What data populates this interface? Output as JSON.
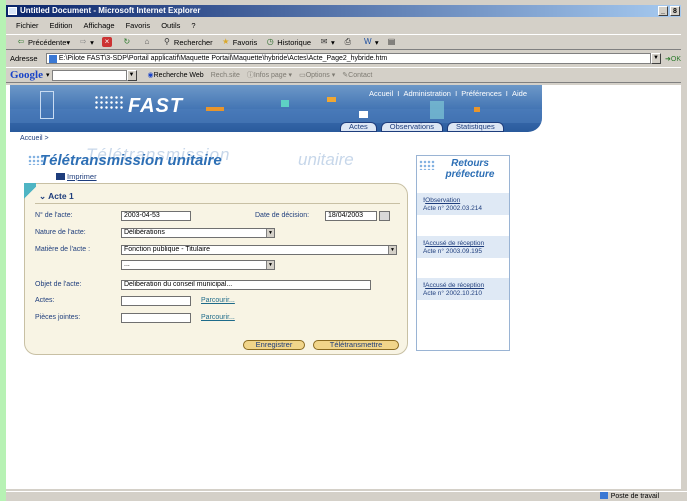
{
  "window": {
    "title": "Untitled Document - Microsoft Internet Explorer",
    "controls": [
      "_",
      "8"
    ]
  },
  "menu": [
    "Fichier",
    "Edition",
    "Affichage",
    "Favoris",
    "Outils",
    "?"
  ],
  "toolbar": {
    "back": "Précédente",
    "search": "Rechercher",
    "favorites": "Favoris",
    "history": "Historique"
  },
  "address": {
    "label": "Adresse",
    "value": "E:\\Pilote FAST\\3-SDP\\Portail applicatif\\Maquette Portail\\Maquette\\hybride\\Actes\\Acte_Page2_hybride.htm",
    "go": "OK"
  },
  "google": {
    "logo": "Google",
    "search_web": "Recherche Web",
    "rech_site": "Rech.site",
    "blocked": "Infos page",
    "options": "Options",
    "contact": "Contact"
  },
  "banner": {
    "brand": "FAST",
    "nav": [
      "Accueil",
      "Administration",
      "Préférences",
      "Aide"
    ],
    "sep": "I",
    "tabs": [
      "Actes",
      "Observations",
      "Statistiques"
    ]
  },
  "breadcrumb": "Accueil >",
  "page": {
    "title": "Télétransmission unitaire",
    "ghost": "Télétransmission",
    "ghost2": "unitaire",
    "print": "Imprimer"
  },
  "form": {
    "heading": "Acte 1",
    "num_label": "N° de l'acte:",
    "num_value": "2003-04-53",
    "date_label": "Date de décision:",
    "date_value": "18/04/2003",
    "nature_label": "Nature de l'acte:",
    "nature_value": "Délibérations",
    "matiere_label": "Matière de l'acte :",
    "matiere_value": "Fonction publique - Titulaire",
    "matiere2_value": "...",
    "objet_label": "Objet de l'acte:",
    "objet_value": "Deliberation du conseil municipal...",
    "actes_label": "Actes:",
    "pj_label": "Pièces jointes:",
    "browse": "Parcourir...",
    "save": "Enregistrer",
    "send": "Télétransmettre"
  },
  "returns": {
    "title_line1": "Retours",
    "title_line2": "préfecture",
    "items": [
      {
        "type": "Observation",
        "ref": "Acte n° 2002.03.214"
      },
      {
        "type": "Accusé de réception",
        "ref": "Acte n° 2003.09.195"
      },
      {
        "type": "Accusé de réception",
        "ref": "Acte n° 2002.10.210"
      }
    ]
  },
  "status": {
    "left": "",
    "zone": "Poste de travail"
  }
}
